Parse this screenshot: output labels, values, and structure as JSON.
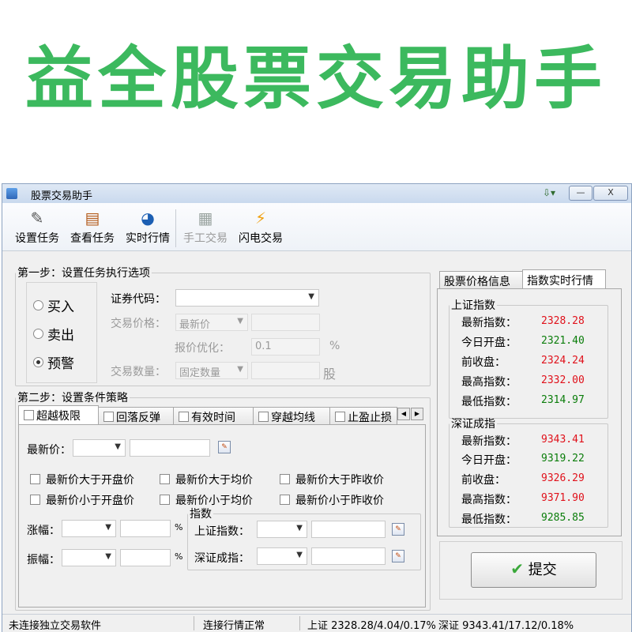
{
  "banner": {
    "text": "益全股票交易助手"
  },
  "window": {
    "title": "股票交易助手",
    "controls": {
      "minimize": "—",
      "close": "X"
    }
  },
  "toolbar": {
    "items": [
      {
        "label": "设置任务",
        "icon": "settings-task-icon"
      },
      {
        "label": "查看任务",
        "icon": "view-task-icon"
      },
      {
        "label": "实时行情",
        "icon": "realtime-quote-icon"
      },
      {
        "label": "手工交易",
        "icon": "manual-trade-icon",
        "disabled": true
      },
      {
        "label": "闪电交易",
        "icon": "lightning-trade-icon"
      }
    ]
  },
  "step1": {
    "legend": "第一步：设置任务执行选项",
    "actions": [
      {
        "label": "买入",
        "selected": false
      },
      {
        "label": "卖出",
        "selected": false
      },
      {
        "label": "预警",
        "selected": true
      }
    ],
    "code_label": "证券代码：",
    "code_value": "",
    "price_label": "交易价格：",
    "price_option": "最新价",
    "price_value": "",
    "opt_label": "报价优化：",
    "opt_value": "0.1",
    "opt_unit": "%",
    "qty_label": "交易数量：",
    "qty_option": "固定数量",
    "qty_value": "",
    "qty_unit": "股"
  },
  "step2": {
    "legend": "第二步：设置条件策略",
    "tabs": [
      "超越极限",
      "回落反弹",
      "有效时间",
      "穿越均线",
      "止盈止损"
    ],
    "latest_price_label": "最新价：",
    "checks": [
      "最新价大于开盘价",
      "最新价大于均价",
      "最新价大于昨收价",
      "最新价小于开盘价",
      "最新价小于均价",
      "最新价小于昨收价"
    ],
    "rise_label": "涨幅：",
    "amp_label": "振幅：",
    "percent": "%",
    "index_group": "指数",
    "sh_label": "上证指数：",
    "sz_label": "深证成指："
  },
  "right": {
    "tabs": [
      "股票价格信息",
      "指数实时行情"
    ],
    "active_tab": 1,
    "sh": {
      "title": "上证指数",
      "rows": [
        {
          "label": "最新指数：",
          "value": "2328.28",
          "color": "red"
        },
        {
          "label": "今日开盘：",
          "value": "2321.40",
          "color": "green"
        },
        {
          "label": "前收盘：",
          "value": "2324.24",
          "color": "red"
        },
        {
          "label": "最高指数：",
          "value": "2332.00",
          "color": "red"
        },
        {
          "label": "最低指数：",
          "value": "2314.97",
          "color": "green"
        }
      ]
    },
    "sz": {
      "title": "深证成指",
      "rows": [
        {
          "label": "最新指数：",
          "value": "9343.41",
          "color": "red"
        },
        {
          "label": "今日开盘：",
          "value": "9319.22",
          "color": "green"
        },
        {
          "label": "前收盘：",
          "value": "9326.29",
          "color": "red"
        },
        {
          "label": "最高指数：",
          "value": "9371.90",
          "color": "red"
        },
        {
          "label": "最低指数：",
          "value": "9285.85",
          "color": "green"
        }
      ]
    },
    "submit_label": "提交"
  },
  "status": {
    "conn": "未连接独立交易软件",
    "quote": "连接行情正常",
    "sh": "上证 2328.28/4.04/0.17%",
    "sz": "深证 9343.41/17.12/0.18%"
  },
  "colors": {
    "banner": "#3cb95e",
    "up": "#e0101a",
    "down": "#0a7d0a"
  }
}
